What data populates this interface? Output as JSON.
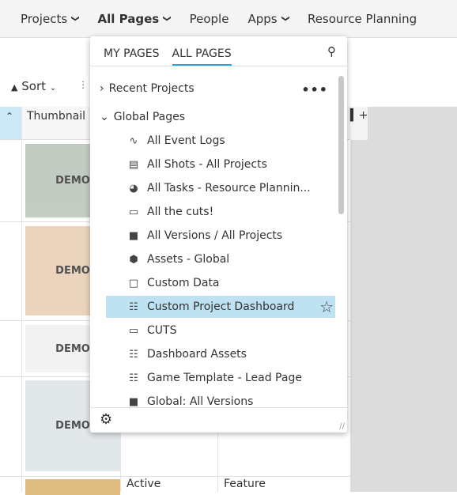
{
  "nav": {
    "items": [
      {
        "label": "Projects",
        "chevron": true
      },
      {
        "label": "All Pages",
        "chevron": true,
        "active": true
      },
      {
        "label": "People",
        "chevron": false
      },
      {
        "label": "Apps",
        "chevron": true
      },
      {
        "label": "Resource Planning",
        "chevron": false
      }
    ]
  },
  "toolbar": {
    "sort_label": "Sort"
  },
  "grid": {
    "header": {
      "thumbnail": "Thumbnail"
    },
    "thumb_label": "DEMO",
    "last_row": {
      "status": "Active",
      "type": "Feature"
    }
  },
  "dropdown": {
    "tabs": [
      {
        "label": "MY PAGES"
      },
      {
        "label": "ALL PAGES",
        "active": true
      }
    ],
    "recent_label": "Recent Projects",
    "more_label": "•••",
    "global_label": "Global Pages",
    "items": [
      {
        "label": "All Event Logs",
        "icon": "pulse-icon"
      },
      {
        "label": "All Shots - All Projects",
        "icon": "film-icon"
      },
      {
        "label": "All Tasks - Resource Plannin...",
        "icon": "check-circle-icon"
      },
      {
        "label": "All the cuts!",
        "icon": "clapper-icon"
      },
      {
        "label": "All Versions / All Projects",
        "icon": "version-icon"
      },
      {
        "label": "Assets - Global",
        "icon": "cube-icon"
      },
      {
        "label": "Custom Data",
        "icon": "square-icon"
      },
      {
        "label": "Custom Project Dashboard",
        "icon": "dashboard-icon",
        "selected": true
      },
      {
        "label": "CUTS",
        "icon": "folder-icon"
      },
      {
        "label": "Dashboard Assets",
        "icon": "dashboard-icon"
      },
      {
        "label": "Game Template - Lead Page",
        "icon": "dashboard-icon"
      },
      {
        "label": "Global: All Versions",
        "icon": "version-icon"
      }
    ]
  },
  "colors": {
    "accent": "#2a9fd8",
    "selected": "#bfe2f3"
  }
}
